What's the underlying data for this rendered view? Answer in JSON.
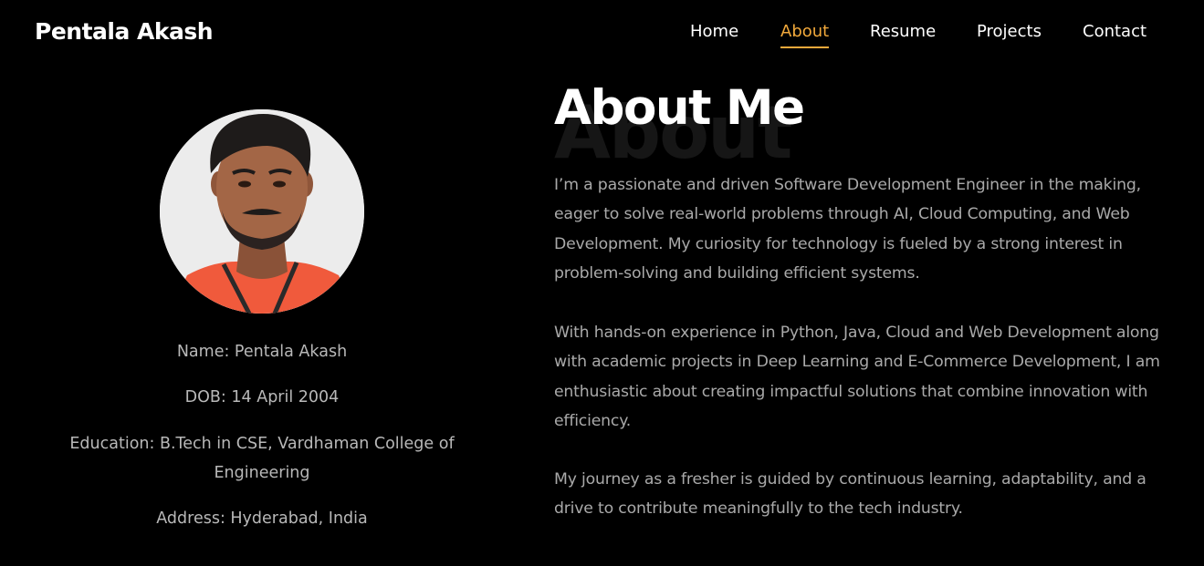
{
  "header": {
    "brand": "Pentala Akash",
    "nav": [
      {
        "label": "Home",
        "active": false
      },
      {
        "label": "About",
        "active": true
      },
      {
        "label": "Resume",
        "active": false
      },
      {
        "label": "Projects",
        "active": false
      },
      {
        "label": "Contact",
        "active": false
      }
    ]
  },
  "profile": {
    "name_line": "Name: Pentala Akash",
    "dob_line": "DOB: 14 April 2004",
    "education_line": "Education: B.Tech in CSE, Vardhaman College of Engineering",
    "address_line": "Address: Hyderabad, India"
  },
  "about": {
    "background_word": "About",
    "title": "About Me",
    "paragraphs": [
      "I’m a passionate and driven Software Development Engineer in the making, eager to solve real-world problems through AI, Cloud Computing, and Web Development. My curiosity for technology is fueled by a strong interest in problem-solving and building efficient systems.",
      "With hands-on experience in Python, Java, Cloud and Web Development along with academic projects in Deep Learning and E-Commerce Development, I am enthusiastic about creating impactful solutions that combine innovation with efficiency.",
      "My journey as a fresher is guided by continuous learning, adaptability, and a drive to contribute meaningfully to the tech industry."
    ]
  },
  "colors": {
    "background": "#000000",
    "accent": "#f2a93b",
    "text_primary": "#ffffff",
    "text_muted": "#a9a9a9"
  }
}
